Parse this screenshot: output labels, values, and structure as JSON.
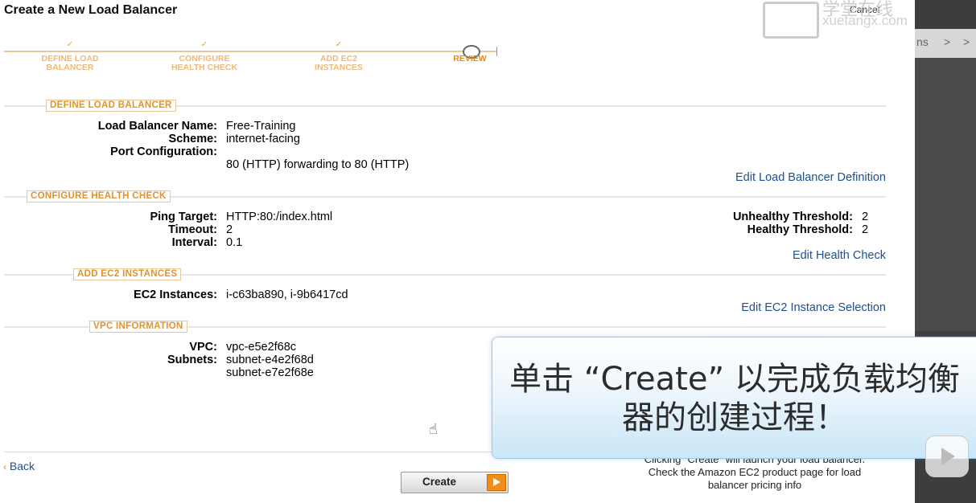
{
  "dialog": {
    "title": "Create a New Load Balancer",
    "cancel": "Cancel"
  },
  "steps": [
    {
      "line1": "DEFINE LOAD",
      "line2": "BALANCER",
      "mark": "✓"
    },
    {
      "line1": "CONFIGURE",
      "line2": "HEALTH CHECK",
      "mark": "✓"
    },
    {
      "line1": "ADD EC2",
      "line2": "INSTANCES",
      "mark": "✓"
    },
    {
      "line1": "REVIEW",
      "line2": "",
      "mark": ""
    }
  ],
  "define": {
    "header": "DEFINE LOAD BALANCER",
    "name_label": "Load Balancer Name:",
    "name_value": "Free-Training",
    "scheme_label": "Scheme:",
    "scheme_value": "internet-facing",
    "port_label": "Port Configuration:",
    "port_value": "80 (HTTP) forwarding to 80 (HTTP)",
    "edit": "Edit Load Balancer Definition"
  },
  "health": {
    "header": "CONFIGURE HEALTH CHECK",
    "ping_label": "Ping Target:",
    "ping_value": "HTTP:80:/index.html",
    "timeout_label": "Timeout:",
    "timeout_value": "2",
    "interval_label": "Interval:",
    "interval_value": "0.1",
    "unhealthy_label": "Unhealthy Threshold:",
    "unhealthy_value": "2",
    "healthy_label": "Healthy Threshold:",
    "healthy_value": "2",
    "edit": "Edit Health Check"
  },
  "ec2": {
    "header": "ADD EC2 INSTANCES",
    "label": "EC2 Instances:",
    "value": "i-c63ba890, i-9b6417cd",
    "edit": "Edit EC2 Instance Selection"
  },
  "vpc": {
    "header": "VPC INFORMATION",
    "vpc_label": "VPC:",
    "vpc_value": "vpc-e5e2f68c",
    "subnets_label": "Subnets:",
    "subnet1": "subnet-e4e2f68d",
    "subnet2": "subnet-e7e2f68e"
  },
  "footer": {
    "back": "Back",
    "create": "Create",
    "note_line1": "Clicking \"Create\" will launch your load balancer.",
    "note_line2": "Check the Amazon EC2 product page for load",
    "note_line3": "balancer pricing info"
  },
  "overlay": {
    "caption_line1": "单击 “Create” 以完成负载均衡",
    "caption_line2": "器的创建过程！"
  },
  "watermark": {
    "text1": "学堂在线",
    "text2": "xuetangx.com"
  },
  "colors": {
    "link": "#1e4f8f",
    "section_label": "#e0922e",
    "create_arrow": "#f08c18"
  }
}
